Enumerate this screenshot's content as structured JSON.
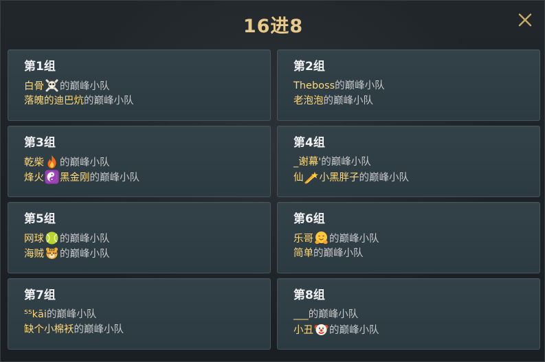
{
  "dialog": {
    "title": "16进8",
    "close_label": "X"
  },
  "team_suffix": "的巅峰小队",
  "groups": [
    {
      "title": "第1组",
      "teams": [
        {
          "name": "白骨",
          "icon": "skull-crossbones-icon"
        },
        {
          "name": "落魄的迪巴炕",
          "icon": ""
        }
      ]
    },
    {
      "title": "第2组",
      "teams": [
        {
          "name": "Theboss",
          "icon": ""
        },
        {
          "name": "老泡泡",
          "icon": ""
        }
      ]
    },
    {
      "title": "第3组",
      "teams": [
        {
          "name": "乾柴",
          "icon": "fire-icon"
        },
        {
          "name": "烽火",
          "name2": "黑金刚",
          "icon": "yin-yang-icon"
        }
      ]
    },
    {
      "title": "第4组",
      "teams": [
        {
          "name": "_谢幕'",
          "icon": ""
        },
        {
          "name": "仙",
          "name2": "小黑胖子",
          "icon": "shooting-star-icon"
        }
      ]
    },
    {
      "title": "第5组",
      "teams": [
        {
          "name": "网球",
          "icon": "tennis-ball-icon"
        },
        {
          "name": "海贼",
          "icon": "tiger-face-icon"
        }
      ]
    },
    {
      "title": "第6组",
      "teams": [
        {
          "name": "乐哥",
          "icon": "hugging-face-icon"
        },
        {
          "name": "简单",
          "icon": ""
        }
      ]
    },
    {
      "title": "第7组",
      "teams": [
        {
          "name": "⁵⁵kāi",
          "icon": ""
        },
        {
          "name": "缺个小棉袄",
          "icon": ""
        }
      ]
    },
    {
      "title": "第8组",
      "teams": [
        {
          "name": "___",
          "icon": ""
        },
        {
          "name": "小丑",
          "icon": "clown-face-icon"
        }
      ]
    }
  ],
  "colors": {
    "title": "#e8c98a",
    "player_name": "#ffd979",
    "suffix_text": "#c8c8c8",
    "card_bg": "#314049"
  }
}
